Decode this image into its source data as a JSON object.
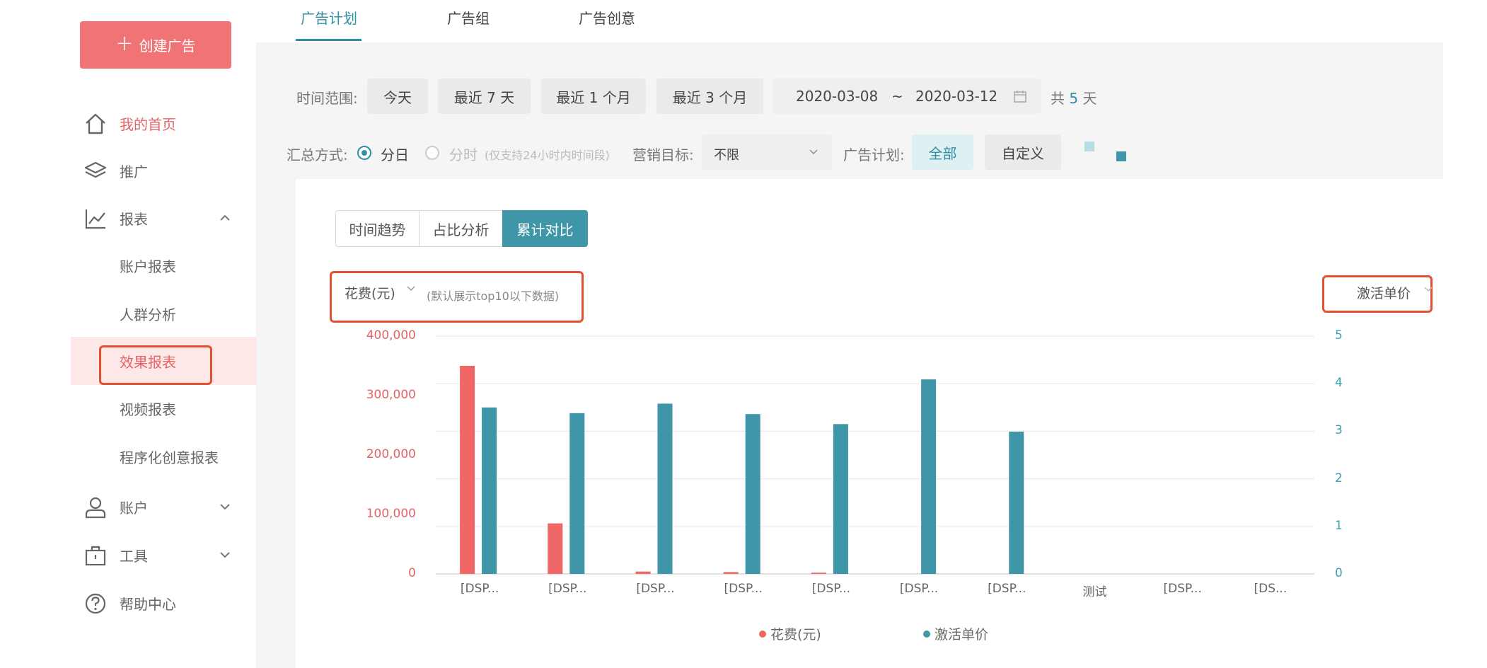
{
  "sidebar": {
    "create_label": "创建广告",
    "nav": {
      "home": "我的首页",
      "promotion": "推广",
      "reports": "报表",
      "account": "账户",
      "tools": "工具",
      "help": "帮助中心"
    },
    "report_sub": {
      "account_report": "账户报表",
      "audience": "人群分析",
      "effect": "效果报表",
      "video": "视频报表",
      "programmatic": "程序化创意报表"
    }
  },
  "tabs": {
    "plan": "广告计划",
    "group": "广告组",
    "creative": "广告创意"
  },
  "filters": {
    "time_label": "时间范围:",
    "today": "今天",
    "last7": "最近 7 天",
    "last1m": "最近 1 个月",
    "last3m": "最近 3 个月",
    "date_start": "2020-03-08",
    "date_sep": "~",
    "date_end": "2020-03-12",
    "total_prefix": "共",
    "total_days": "5",
    "total_suffix": "天",
    "agg_label": "汇总方式:",
    "agg_day": "分日",
    "agg_hour": "分时",
    "agg_hour_note": "(仅支持24小时内时间段)",
    "goal_label": "营销目标:",
    "goal_value": "不限",
    "plan_label": "广告计划:",
    "plan_all": "全部",
    "plan_custom": "自定义"
  },
  "view_tabs": {
    "trend": "时间趋势",
    "ratio": "占比分析",
    "cumulative": "累计对比"
  },
  "chart_controls": {
    "left_metric": "花费(元)",
    "left_note": "(默认展示top10以下数据)",
    "right_metric": "激活单价"
  },
  "chart_data": {
    "type": "bar",
    "categories": [
      "[DSP...",
      "[DSP...",
      "[DSP...",
      "[DSP...",
      "[DSP...",
      "[DSP...",
      "[DSP...",
      "测试",
      "[DSP...",
      "[DS..."
    ],
    "series": [
      {
        "name": "花费(元)",
        "axis": "left",
        "color": "#ee6666",
        "values": [
          350000,
          85000,
          4000,
          3000,
          2000,
          0,
          0,
          0,
          0,
          0
        ]
      },
      {
        "name": "激活单价",
        "axis": "right",
        "color": "#3f96a8",
        "values": [
          3.5,
          3.38,
          3.58,
          3.36,
          3.15,
          4.09,
          2.99,
          0,
          0,
          0
        ]
      }
    ],
    "y_left": {
      "ticks": [
        "0",
        "100,000",
        "200,000",
        "300,000",
        "400,000"
      ],
      "range": [
        0,
        400000
      ]
    },
    "y_right": {
      "ticks": [
        "0",
        "1",
        "2",
        "3",
        "4",
        "5"
      ],
      "range": [
        0,
        5
      ]
    },
    "legend_position": "bottom-center",
    "grid": true
  }
}
